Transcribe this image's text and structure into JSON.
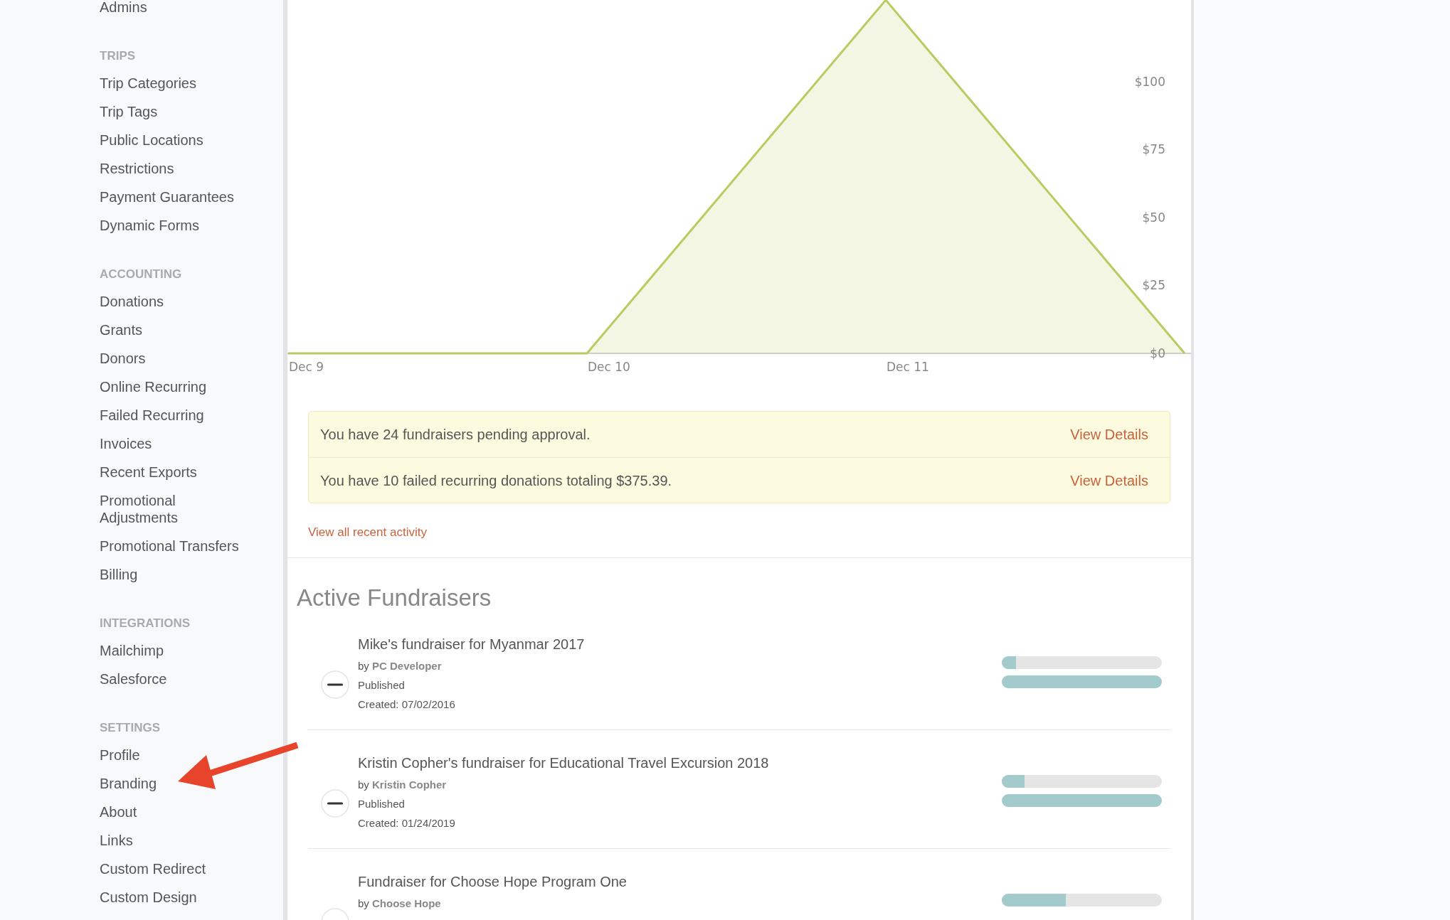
{
  "sidebar": {
    "top_items": [
      {
        "label": "Admins"
      }
    ],
    "sections": [
      {
        "heading": "TRIPS",
        "items": [
          {
            "label": "Trip Categories"
          },
          {
            "label": "Trip Tags"
          },
          {
            "label": "Public Locations"
          },
          {
            "label": "Restrictions"
          },
          {
            "label": "Payment Guarantees"
          },
          {
            "label": "Dynamic Forms"
          }
        ]
      },
      {
        "heading": "ACCOUNTING",
        "items": [
          {
            "label": "Donations"
          },
          {
            "label": "Grants"
          },
          {
            "label": "Donors"
          },
          {
            "label": "Online Recurring"
          },
          {
            "label": "Failed Recurring"
          },
          {
            "label": "Invoices"
          },
          {
            "label": "Recent Exports"
          },
          {
            "label": "Promotional Adjustments"
          },
          {
            "label": "Promotional Transfers"
          },
          {
            "label": "Billing"
          }
        ]
      },
      {
        "heading": "INTEGRATIONS",
        "items": [
          {
            "label": "Mailchimp"
          },
          {
            "label": "Salesforce"
          }
        ]
      },
      {
        "heading": "SETTINGS",
        "items": [
          {
            "label": "Profile"
          },
          {
            "label": "Branding"
          },
          {
            "label": "About"
          },
          {
            "label": "Links"
          },
          {
            "label": "Custom Redirect"
          },
          {
            "label": "Custom Design"
          }
        ]
      }
    ]
  },
  "chart": {
    "chart_data": {
      "type": "area",
      "categories": [
        "Dec 9",
        "Dec 10",
        "Dec 11",
        null
      ],
      "series": [
        {
          "color": "#b8cc62",
          "values": [
            0,
            0,
            130,
            0
          ]
        }
      ],
      "ylim": [
        0,
        130
      ],
      "yticks": [
        {
          "value": 0,
          "label": "$0"
        },
        {
          "value": 25,
          "label": "$25"
        },
        {
          "value": 50,
          "label": "$50"
        },
        {
          "value": 75,
          "label": "$75"
        },
        {
          "value": 100,
          "label": "$100"
        }
      ]
    }
  },
  "alerts": [
    {
      "text": "You have 24 fundraisers pending approval.",
      "link": "View Details"
    },
    {
      "text": "You have 10 failed recurring donations totaling $375.39.",
      "link": "View Details"
    }
  ],
  "recent_activity_link": "View all recent activity",
  "active_fundraisers": {
    "title": "Active Fundraisers",
    "items": [
      {
        "title": "Mike's fundraiser for Myanmar 2017",
        "byline": "by **PC Developer**",
        "status": "Published",
        "created": "Created: 07/02/2016",
        "progress": [
          {
            "level": 0.09
          },
          {
            "level": 1
          }
        ]
      },
      {
        "title": "Kristin Copher's fundraiser for Educational Travel Excursion 2018",
        "byline": "by **Kristin Copher**",
        "status": "Published",
        "created": "Created: 01/24/2019",
        "progress": [
          {
            "level": 0.14
          },
          {
            "level": 1
          }
        ]
      },
      {
        "title": "Fundraiser for Choose Hope Program One",
        "byline": "by **Choose Hope**",
        "progress": [
          {
            "level": 0.4
          }
        ]
      }
    ]
  }
}
